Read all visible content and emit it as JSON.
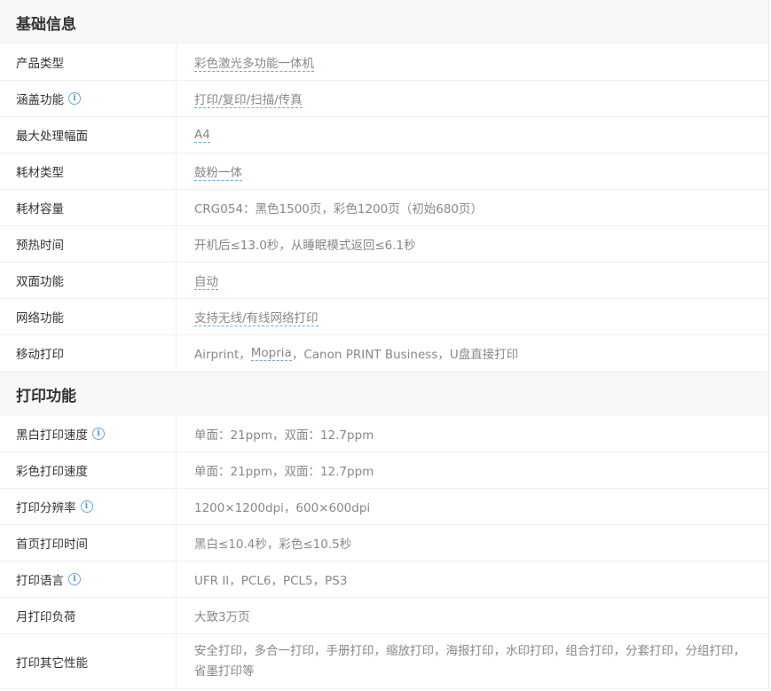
{
  "sections": [
    {
      "title": "基础信息",
      "rows": [
        {
          "label": "产品类型",
          "value": "彩色激光多功能一体机"
        },
        {
          "label": "涵盖功能",
          "value": "打印/复印/扫描/传真"
        },
        {
          "label": "最大处理幅面",
          "value": "A4"
        },
        {
          "label": "耗材类型",
          "value": "鼓粉一体"
        },
        {
          "label": "耗材容量",
          "value": "CRG054：黑色1500页，彩色1200页（初始680页）"
        },
        {
          "label": "预热时间",
          "value": "开机后≤13.0秒，从睡眠模式返回≤6.1秒"
        },
        {
          "label": "双面功能",
          "value": "自动"
        },
        {
          "label": "网络功能",
          "value": "支持无线/有线网络打印"
        },
        {
          "label": "移动打印",
          "value_parts": [
            "Airprint，",
            "Mopria",
            "，Canon PRINT Business，U盘直接打印"
          ]
        }
      ]
    },
    {
      "title": "打印功能",
      "rows": [
        {
          "label": "黑白打印速度",
          "value": "单面：21ppm，双面：12.7ppm"
        },
        {
          "label": "彩色打印速度",
          "value": "单面：21ppm，双面：12.7ppm"
        },
        {
          "label": "打印分辨率",
          "value": "1200×1200dpi，600×600dpi"
        },
        {
          "label": "首页打印时间",
          "value": "黑白≤10.4秒，彩色≤10.5秒"
        },
        {
          "label": "打印语言",
          "value": "UFR II，PCL6，PCL5，PS3"
        },
        {
          "label": "月打印负荷",
          "value": "大致3万页"
        },
        {
          "label": "打印其它性能",
          "value": "安全打印，多合一打印，手册打印，缩放打印，海报打印，水印打印，组合打印，分套打印，分组打印，省墨打印等"
        }
      ]
    }
  ],
  "info_icon": "ⓘ"
}
